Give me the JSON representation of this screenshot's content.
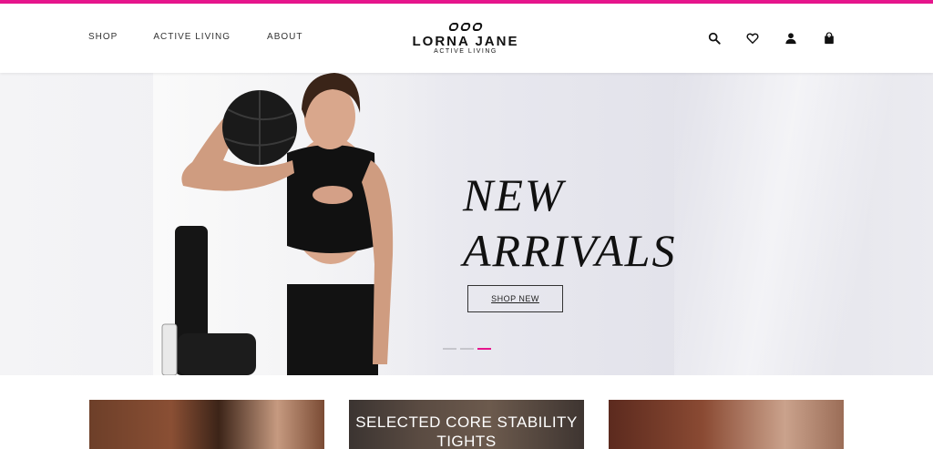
{
  "brand": {
    "name": "LORNA JANE",
    "tagline": "ACTIVE LIVING",
    "accent_color": "#e6158c"
  },
  "nav": {
    "items": [
      {
        "label": "SHOP"
      },
      {
        "label": "ACTIVE LIVING"
      },
      {
        "label": "ABOUT"
      }
    ]
  },
  "header_icons": {
    "search": "search-icon",
    "wishlist": "heart-icon",
    "account": "user-icon",
    "cart": "shopping-bag-icon",
    "cart_count": "0"
  },
  "hero": {
    "headline_line1": "NEW",
    "headline_line2": "ARRIVALS",
    "cta_label": "SHOP NEW",
    "slides_total": 3,
    "active_slide": 3
  },
  "tiles": [
    {
      "text": ""
    },
    {
      "text": "SELECTED CORE STABILITY TIGHTS"
    },
    {
      "text": ""
    }
  ]
}
